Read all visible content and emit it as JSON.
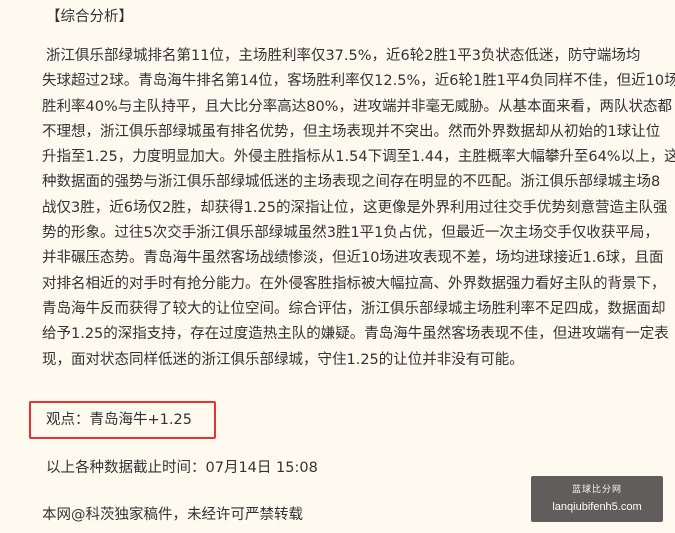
{
  "article": {
    "section_title": "【综合分析】",
    "paragraph_lines": [
      "浙江俱乐部绿城排名第11位，主场胜利率仅37.5%，近6轮2胜1平3负状态低迷，防守端场均",
      "失球超过2球。青岛海牛排名第14位，客场胜利率仅12.5%，近6轮1胜1平4负同样不佳，但近10场",
      "胜利率40%与主队持平，且大比分率高达80%，进攻端并非毫无威胁。从基本面来看，两队状态都",
      "不理想，浙江俱乐部绿城虽有排名优势，但主场表现并不突出。然而外界数据却从初始的1球让位",
      "升指至1.25，力度明显加大。外侵主胜指标从1.54下调至1.44，主胜概率大幅攀升至64%以上，这",
      "种数据面的强势与浙江俱乐部绿城低迷的主场表现之间存在明显的不匹配。浙江俱乐部绿城主场8",
      "战仅3胜，近6场仅2胜，却获得1.25的深指让位，这更像是外界利用过往交手优势刻意营造主队强",
      "势的形象。过往5次交手浙江俱乐部绿城虽然3胜1平1负占优，但最近一次主场交手仅收获平局，",
      "并非碾压态势。青岛海牛虽然客场战绩惨淡，但近10场进攻表现不差，场均进球接近1.6球，且面",
      "对排名相近的对手时有抢分能力。在外侵客胜指标被大幅拉高、外界数据强力看好主队的背景下，",
      "青岛海牛反而获得了较大的让位空间。综合评估，浙江俱乐部绿城主场胜利率不足四成，数据面却",
      "给予1.25的深指支持，存在过度造热主队的嫌疑。青岛海牛虽然客场表现不佳，但进攻端有一定表",
      "现，面对状态同样低迷的浙江俱乐部绿城，守住1.25的让位并非没有可能。"
    ],
    "opinion": "观点：青岛海牛+1.25",
    "deadline": "以上各种数据截止时间：07月14日 15:08",
    "copyright": "本网@科茨独家稿件，未经许可严禁转载"
  },
  "watermark": {
    "logo_text": "蓝球比分网",
    "url": "lanqiubifenh5.com"
  },
  "colors": {
    "background": "#fefaf0",
    "text": "#333333",
    "highlight_border": "#e8322e"
  }
}
